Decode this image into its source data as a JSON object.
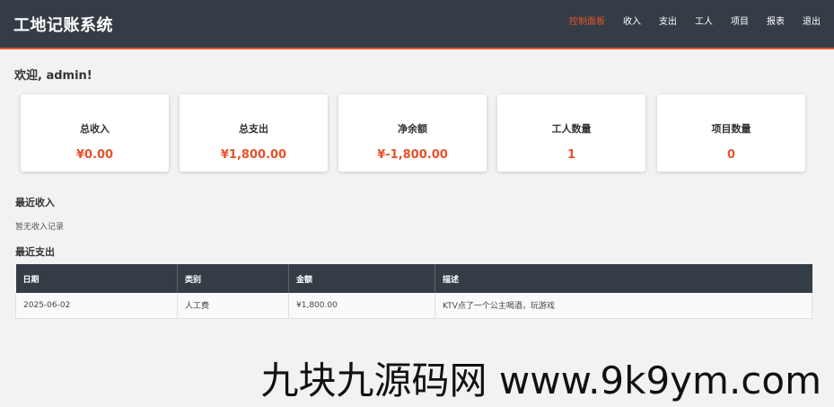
{
  "header": {
    "title": "工地记账系统",
    "nav": [
      {
        "label": "控制面板",
        "active": true
      },
      {
        "label": "收入",
        "active": false
      },
      {
        "label": "支出",
        "active": false
      },
      {
        "label": "工人",
        "active": false
      },
      {
        "label": "项目",
        "active": false
      },
      {
        "label": "报表",
        "active": false
      },
      {
        "label": "退出",
        "active": false
      }
    ]
  },
  "welcome": "欢迎, admin!",
  "cards": [
    {
      "label": "总收入",
      "value": "¥0.00"
    },
    {
      "label": "总支出",
      "value": "¥1,800.00"
    },
    {
      "label": "净余额",
      "value": "¥-1,800.00"
    },
    {
      "label": "工人数量",
      "value": "1"
    },
    {
      "label": "项目数量",
      "value": "0"
    }
  ],
  "recent_income": {
    "title": "最近收入",
    "empty_text": "暂无收入记录"
  },
  "recent_expense": {
    "title": "最近支出",
    "columns": [
      "日期",
      "类别",
      "金额",
      "描述"
    ],
    "rows": [
      [
        "2025-06-02",
        "人工费",
        "¥1,800.00",
        "KTV点了一个公主喝酒，玩游戏"
      ]
    ]
  },
  "watermark": "九块九源码网 www.9k9ym.com",
  "colors": {
    "header_bg": "#343d46",
    "accent": "#e8522a",
    "page_bg": "#f2f2f2"
  }
}
